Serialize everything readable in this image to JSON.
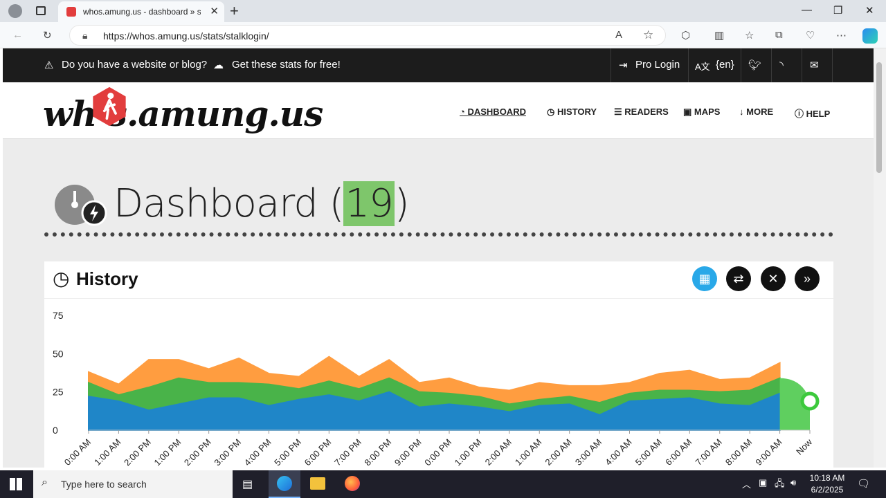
{
  "browser": {
    "tab_title": "whos.amung.us - dashboard » st",
    "url": "https://whos.amung.us/stats/stalklogin/"
  },
  "topbar": {
    "promo_question": "Do you have a website or blog?",
    "promo_cta": "Get these stats for free!",
    "pro_login": "Pro Login",
    "language": "{en}"
  },
  "site": {
    "logo_text": "wh  s.amung.us",
    "menu": [
      "DASHBOARD",
      "HISTORY",
      "READERS",
      "MAPS",
      "MORE",
      "HELP"
    ]
  },
  "dashboard": {
    "title": "Dashboard (",
    "count": "19",
    "title_close": ")"
  },
  "history": {
    "title": "History"
  },
  "chart_data": {
    "type": "area",
    "y_ticks": [
      "75",
      "50",
      "25",
      "0"
    ],
    "ylim": [
      0,
      75
    ],
    "x": [
      "0:00 AM",
      "1:00 AM",
      "2:00 PM",
      "1:00 PM",
      "2:00 PM",
      "3:00 PM",
      "4:00 PM",
      "5:00 PM",
      "6:00 PM",
      "7:00 PM",
      "8:00 PM",
      "9:00 PM",
      "0:00 PM",
      "1:00 PM",
      "2:00 AM",
      "1:00 AM",
      "2:00 AM",
      "3:00 AM",
      "4:00 AM",
      "5:00 AM",
      "6:00 AM",
      "7:00 AM",
      "8:00 AM",
      "9:00 AM",
      "Now"
    ],
    "series": [
      {
        "values": [
          22,
          19,
          13,
          17,
          21,
          21,
          16,
          20,
          23,
          19,
          25,
          15,
          17,
          15,
          12,
          16,
          17,
          10,
          19,
          20,
          21,
          17,
          16,
          24,
          19
        ],
        "color": "#1f86c8"
      },
      {
        "values": [
          31,
          23,
          28,
          34,
          31,
          31,
          30,
          27,
          32,
          27,
          34,
          25,
          24,
          22,
          17,
          20,
          22,
          18,
          24,
          26,
          26,
          25,
          26,
          34,
          19
        ],
        "color": "#49b349"
      },
      {
        "values": [
          38,
          30,
          46,
          46,
          40,
          47,
          37,
          35,
          48,
          35,
          46,
          31,
          34,
          28,
          26,
          31,
          29,
          29,
          31,
          37,
          39,
          33,
          34,
          44,
          19
        ],
        "color": "#ff9d40"
      }
    ],
    "now_value": 19
  },
  "taskbar": {
    "search_placeholder": "Type here to search",
    "time": "10:18 AM",
    "date": "6/2/2025"
  }
}
